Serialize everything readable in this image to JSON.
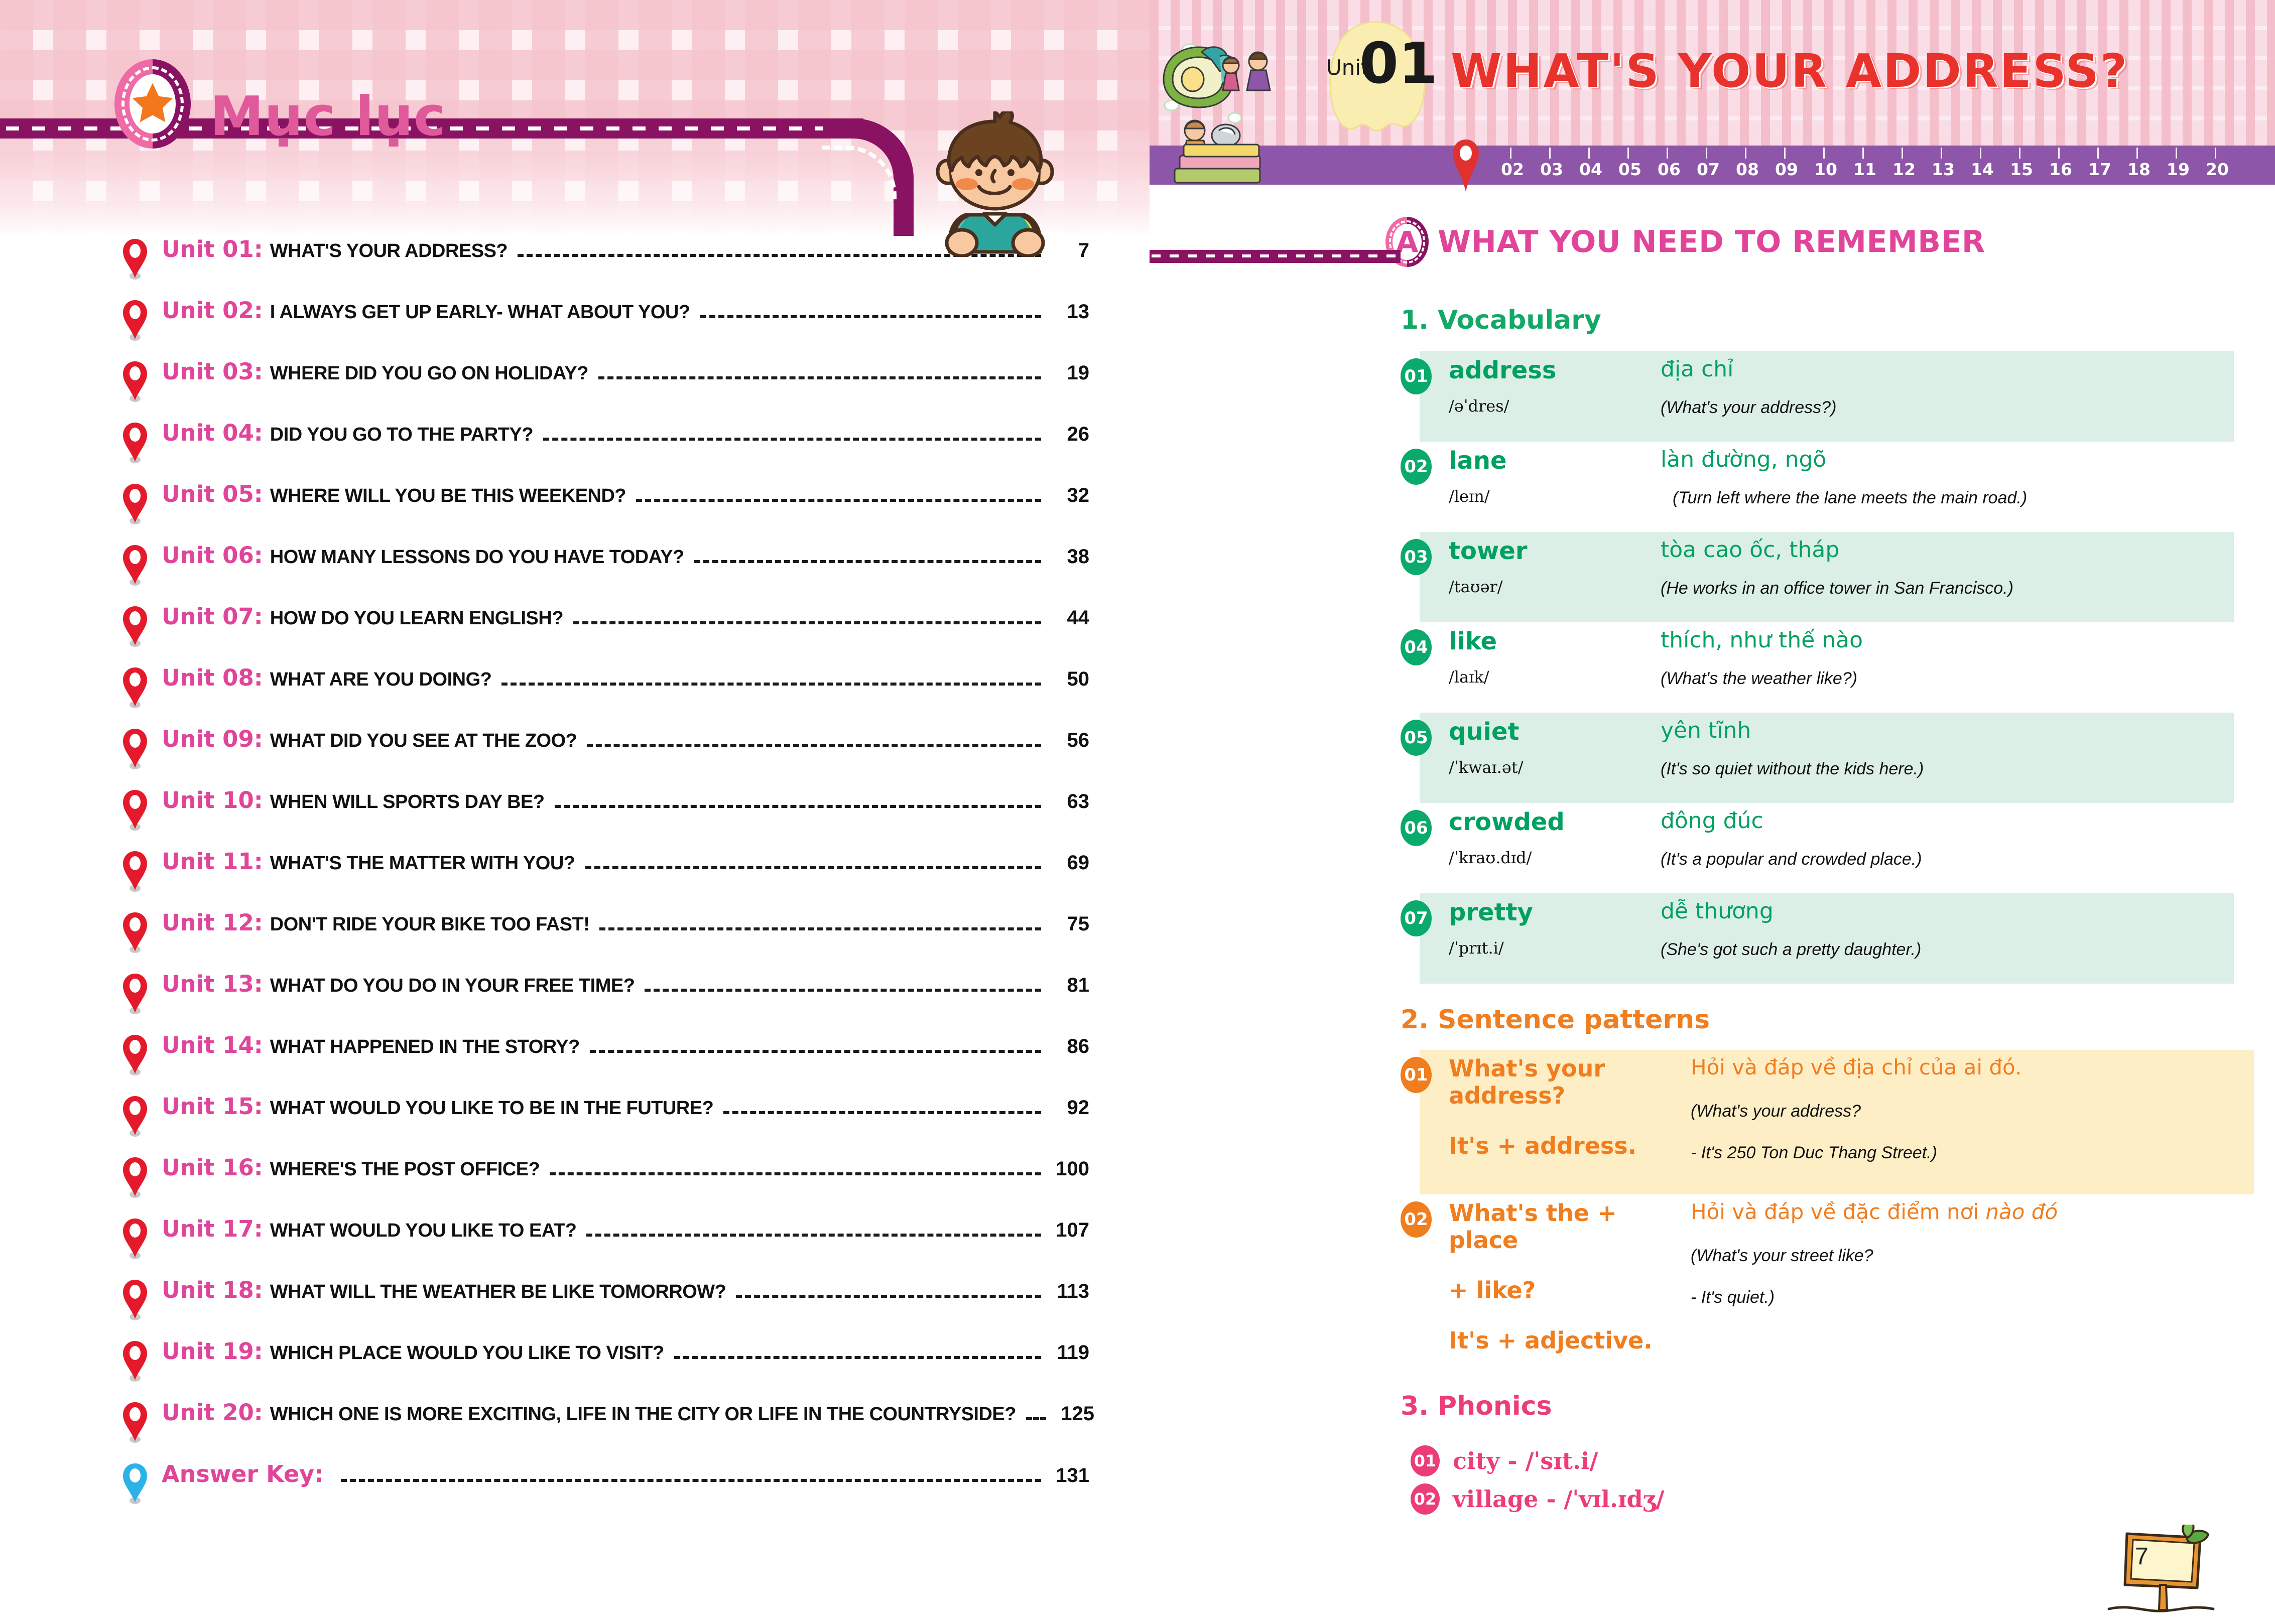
{
  "left_page": {
    "title": "Mục lục",
    "star_icon": "star-icon",
    "toc": [
      {
        "unit": "Unit 01:",
        "name": "WHAT'S YOUR ADDRESS?",
        "page": "7"
      },
      {
        "unit": "Unit 02:",
        "name": "I ALWAYS GET UP EARLY- WHAT ABOUT YOU?",
        "page": "13"
      },
      {
        "unit": "Unit 03:",
        "name": "WHERE DID YOU GO ON HOLIDAY?",
        "page": "19"
      },
      {
        "unit": "Unit 04:",
        "name": "DID YOU GO TO THE PARTY?",
        "page": "26"
      },
      {
        "unit": "Unit 05:",
        "name": "WHERE WILL YOU BE THIS WEEKEND?",
        "page": "32"
      },
      {
        "unit": "Unit 06:",
        "name": "HOW MANY LESSONS DO YOU HAVE TODAY?",
        "page": "38"
      },
      {
        "unit": "Unit 07:",
        "name": "HOW DO YOU LEARN ENGLISH?",
        "page": "44"
      },
      {
        "unit": "Unit 08:",
        "name": "WHAT ARE YOU DOING?",
        "page": "50"
      },
      {
        "unit": "Unit 09:",
        "name": "WHAT DID YOU SEE AT THE ZOO?",
        "page": "56"
      },
      {
        "unit": "Unit 10:",
        "name": "WHEN WILL SPORTS DAY BE?",
        "page": "63"
      },
      {
        "unit": "Unit 11:",
        "name": "WHAT'S THE MATTER WITH YOU?",
        "page": "69"
      },
      {
        "unit": "Unit 12:",
        "name": "DON'T RIDE YOUR BIKE TOO FAST!",
        "page": "75"
      },
      {
        "unit": "Unit 13:",
        "name": "WHAT DO YOU DO IN YOUR FREE TIME?",
        "page": "81"
      },
      {
        "unit": "Unit 14:",
        "name": "WHAT HAPPENED IN THE STORY?",
        "page": "86"
      },
      {
        "unit": "Unit 15:",
        "name": "WHAT WOULD YOU LIKE TO BE IN THE FUTURE?",
        "page": "92"
      },
      {
        "unit": "Unit 16:",
        "name": "WHERE'S THE POST OFFICE?",
        "page": "100"
      },
      {
        "unit": "Unit 17:",
        "name": "WHAT WOULD YOU LIKE TO EAT?",
        "page": "107"
      },
      {
        "unit": "Unit 18:",
        "name": "WHAT WILL THE WEATHER BE LIKE TOMORROW?",
        "page": "113"
      },
      {
        "unit": "Unit 19:",
        "name": "WHICH PLACE WOULD YOU LIKE TO VISIT?",
        "page": "119"
      },
      {
        "unit": "Unit 20:",
        "name": "WHICH ONE IS MORE EXCITING, LIFE IN THE CITY OR LIFE IN THE COUNTRYSIDE?",
        "page": "125"
      },
      {
        "unit": "Answer Key:",
        "name": "",
        "page": "131"
      }
    ]
  },
  "right_page": {
    "unit_label": "Unit",
    "unit_number": "01",
    "unit_title": "WHAT'S YOUR ADDRESS?",
    "progress": {
      "current_marker": "map-pin-icon",
      "ticks": [
        "02",
        "03",
        "04",
        "05",
        "06",
        "07",
        "08",
        "09",
        "10",
        "11",
        "12",
        "13",
        "14",
        "15",
        "16",
        "17",
        "18",
        "19",
        "20"
      ]
    },
    "section_a": {
      "badge": "A",
      "title": "WHAT YOU NEED TO REMEMBER"
    },
    "vocabulary": {
      "heading": "1. Vocabulary",
      "items": [
        {
          "no": "01",
          "word": "address",
          "ipa": "/əˈdres/",
          "vn": "địa chỉ",
          "example": "(What's your address?)"
        },
        {
          "no": "02",
          "word": "lane",
          "ipa": "/leɪn/",
          "vn": "làn đường, ngõ",
          "example": "(Turn left where the lane meets the main road.)"
        },
        {
          "no": "03",
          "word": "tower",
          "ipa": "/taʊər/",
          "vn": "tòa cao ốc, tháp",
          "example": "(He works in an office tower in San Francisco.)"
        },
        {
          "no": "04",
          "word": "like",
          "ipa": "/laɪk/",
          "vn": "thích, như thế nào",
          "example": "(What's the weather like?)"
        },
        {
          "no": "05",
          "word": "quiet",
          "ipa": "/ˈkwaɪ.ət/",
          "vn": "yên tĩnh",
          "example": "(It's so quiet without the kids here.)"
        },
        {
          "no": "06",
          "word": "crowded",
          "ipa": "/ˈkraʊ.dɪd/",
          "vn": "đông đúc",
          "example": "(It's a popular and crowded place.)"
        },
        {
          "no": "07",
          "word": "pretty",
          "ipa": "/ˈprɪt.i/",
          "vn": "dễ thương",
          "example": "(She's got such a pretty daughter.)"
        }
      ]
    },
    "sentence_patterns": {
      "heading": "2. Sentence patterns",
      "items": [
        {
          "no": "01",
          "pattern_line1": "What's your address?",
          "pattern_line2": "It's + address.",
          "vn": "Hỏi và đáp về địa chỉ của ai đó.",
          "example_line1": "(What's your address?",
          "example_line2": "- It's 250 Ton Duc Thang Street.)"
        },
        {
          "no": "02",
          "pattern_line1": "What's the + place",
          "pattern_line2": "+ like?",
          "pattern_line3": "It's + adjective.",
          "vn_plain": "Hỏi và đáp về đặc điểm nơi ",
          "vn_italic": "nào đó",
          "example_line1": "(What's your street like?",
          "example_line2": "- It's quiet.)"
        }
      ]
    },
    "phonics": {
      "heading": "3. Phonics",
      "items": [
        {
          "no": "01",
          "text": "city -  /ˈsɪt.i/"
        },
        {
          "no": "02",
          "text": "village - /ˈvɪl.ɪdʒ/"
        }
      ]
    },
    "page_number": "7"
  },
  "colors": {
    "pink_accent": "#e0459a",
    "purple_rail": "#8a1262",
    "purple_bar": "#8e56a8",
    "green": "#00a160",
    "orange": "#f07d1e",
    "red_title": "#e8322b",
    "phonics_pink": "#ec3d78"
  }
}
